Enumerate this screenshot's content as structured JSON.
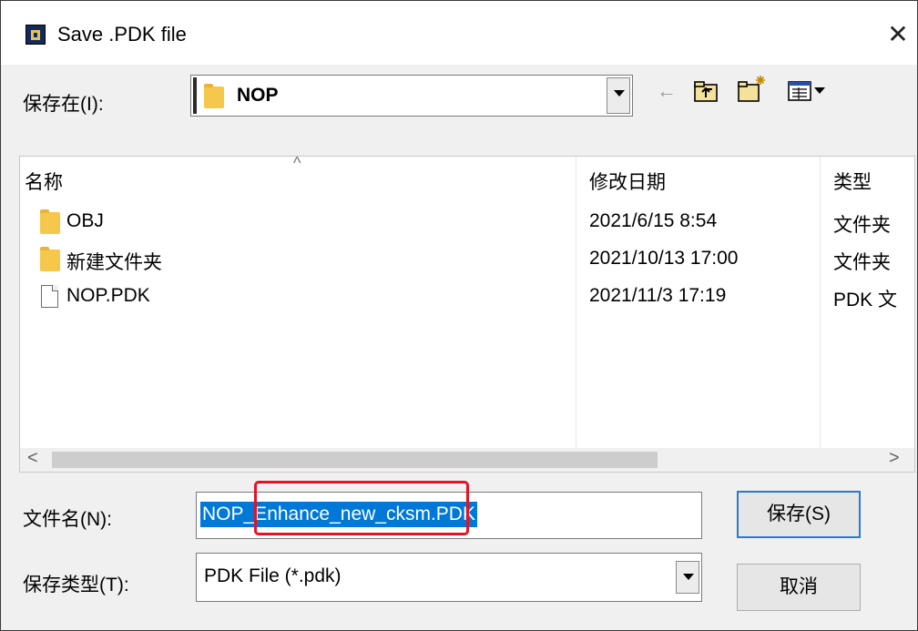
{
  "window": {
    "title": "Save .PDK file",
    "close_glyph": "✕"
  },
  "save_in": {
    "label": "保存在(I):",
    "value": "NOP"
  },
  "toolbar": {
    "back_glyph": "←"
  },
  "list": {
    "columns": {
      "name": "名称",
      "modified": "修改日期",
      "type": "类型"
    },
    "sort_glyph": "^",
    "items": [
      {
        "name": "OBJ",
        "modified": "2021/6/15 8:54",
        "type": "文件夹",
        "icon": "folder-icon"
      },
      {
        "name": "新建文件夹",
        "modified": "2021/10/13 17:00",
        "type": "文件夹",
        "icon": "folder-icon"
      },
      {
        "name": "NOP.PDK",
        "modified": "2021/11/3 17:19",
        "type": "PDK 文",
        "icon": "file-icon"
      }
    ],
    "scroll_left": "<",
    "scroll_right": ">"
  },
  "filename": {
    "label": "文件名(N):",
    "value": "NOP_Enhance_new_cksm.PDK"
  },
  "filetype": {
    "label": "保存类型(T):",
    "value": "PDK File (*.pdk)"
  },
  "buttons": {
    "save": "保存(S)",
    "cancel": "取消"
  },
  "colors": {
    "selection": "#0078d7",
    "highlight_box": "#e81123",
    "folder": "#f5c84b",
    "default_button_border": "#2a7ad0"
  }
}
